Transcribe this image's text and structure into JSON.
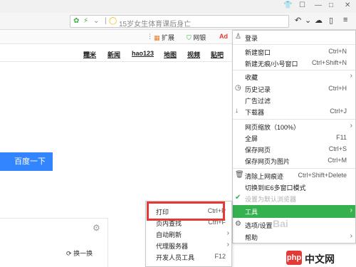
{
  "browser": {
    "url_text": "15岁女生体育课后身亡",
    "window_controls": [
      "shirt-icon",
      "minimize-icon",
      "maximize-icon",
      "close-icon"
    ]
  },
  "extbar": {
    "items": [
      {
        "icon": "grid-icon",
        "label": "扩展"
      },
      {
        "icon": "shield-icon",
        "label": "网银"
      },
      {
        "icon": "ad-icon",
        "label": "Ad"
      }
    ]
  },
  "page": {
    "nav_links": [
      "糯米",
      "新闻",
      "hao123",
      "地图",
      "视频",
      "贴吧"
    ],
    "search_button": "百度一下",
    "refresh_label": "换一换"
  },
  "menu": {
    "items": [
      {
        "label": "登录",
        "icon": "user-icon"
      },
      {
        "label": "新建窗口",
        "shortcut": "Ctrl+N"
      },
      {
        "label": "新建无痕/小号窗口",
        "shortcut": "Ctrl+Shift+N"
      },
      {
        "label": "收藏",
        "arrow": true
      },
      {
        "label": "历史记录",
        "shortcut": "Ctrl+H",
        "icon": "clock-icon"
      },
      {
        "label": "广告过滤"
      },
      {
        "label": "下载器",
        "shortcut": "Ctrl+J",
        "icon": "download-icon"
      },
      {
        "label": "网页缩放（100%）",
        "arrow": true
      },
      {
        "label": "全屏",
        "shortcut": "F11"
      },
      {
        "label": "保存网页",
        "shortcut": "Ctrl+S"
      },
      {
        "label": "保存网页为图片",
        "shortcut": "Ctrl+M"
      },
      {
        "label": "清除上网痕迹",
        "shortcut": "Ctrl+Shift+Delete",
        "icon": "trash-icon"
      },
      {
        "label": "切换到IE6多窗口模式"
      },
      {
        "label": "设置为默认浏览器",
        "disabled": true,
        "icon": "check-icon"
      },
      {
        "label": "工具",
        "arrow": true
      },
      {
        "label": "选项/设置",
        "icon": "gear-icon"
      },
      {
        "label": "帮助",
        "arrow": true
      }
    ]
  },
  "submenu": {
    "items": [
      {
        "label": "打印",
        "shortcut": "Ctrl+P"
      },
      {
        "label": "页内查找",
        "shortcut": "Ctrl+F"
      },
      {
        "label": "自动刷新",
        "arrow": true
      },
      {
        "label": "代理服务器",
        "arrow": true
      },
      {
        "label": "开发人员工具",
        "shortcut": "F12"
      }
    ]
  },
  "colors": {
    "highlight": "#35b24f",
    "search_button": "#3385ff",
    "red_box": "#e53935"
  },
  "watermark": {
    "logo_text": "php",
    "text": "中文网",
    "ghost": "Bai"
  }
}
